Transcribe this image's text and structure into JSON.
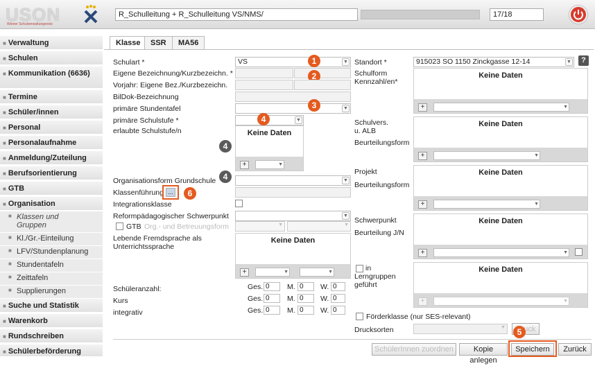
{
  "topbar": {
    "logo_text": "USON",
    "logo_sub": "Wiener Schulverwaltungsnetz",
    "title_field": "R_Schulleitung + R_Schulleitung VS/NMS/",
    "year_field": "17/18"
  },
  "sidebar": {
    "items": [
      "Verwaltung",
      "Schulen",
      "Kommunikation (6636)",
      "Termine",
      "Schüler/innen",
      "Personal",
      "Personalaufnahme",
      "Anmeldung/Zuteilung",
      "Berufsorientierung",
      "GTB",
      "Organisation",
      "Suche und Statistik",
      "Warenkorb",
      "Rundschreiben",
      "Schülerbeförderung"
    ],
    "sub": [
      "Klassen und Gruppen",
      "Kl./Gr.-Einteilung",
      "LFV/Stundenplanung",
      "Stundentafeln",
      "Zeittafeln",
      "Supplierungen"
    ]
  },
  "tabs": [
    "Klasse",
    "SSR",
    "MA56"
  ],
  "form": {
    "schulart_label": "Schulart *",
    "schulart_value": "VS",
    "eig_bez_label": "Eigene Bezeichnung/Kurzbezeichn. *",
    "vorjahr_label": "Vorjahr: Eigene Bez./Kurzbezeichn.",
    "bildok_label": "BilDok-Bezeichnung",
    "prim_stundentafel_label": "primäre Stundentafel",
    "prim_schulstufe_label": "primäre Schulstufe *",
    "erlaubte_label": "erlaubte Schulstufe/n",
    "keine_daten": "Keine Daten",
    "orgform_label": "Organisationsform Grundschule",
    "klassenfuehrung_label": "Klassenführung",
    "klassenfuehrung_btn": "...",
    "integration_label": "Integrationsklasse",
    "reform_label": "Reformpädagogischer Schwerpunkt",
    "gtb_label": "GTB",
    "gtb_form_label": "Org.- und Betreuungsform",
    "fremdsprache_label": "Lebende Fremdsprache als Unterrichtssprache",
    "schueleranzahl_label": "Schüleranzahl:",
    "kurs_label": "Kurs",
    "integrativ_label": "integrativ",
    "ges": "Ges.",
    "m": "M.",
    "w": "W.",
    "zero": "0",
    "standort_label": "Standort *",
    "standort_value": "915023 SO 1150 Zinckgasse 12-14",
    "schulform_label": "Schulform Kennzahl/en*",
    "schulvers_label": "Schulvers. u. ALB",
    "beurteilungsform_label": "Beurteilungsform",
    "projekt_label": "Projekt",
    "schwerpunkt_label": "Schwerpunkt",
    "beurteilung_jn_label": "Beurteilung J/N",
    "lerngruppen_label": "in Lerngruppen geführt",
    "foerder_label": "Förderklasse (nur SES-relevant)",
    "drucksorten_label": "Drucksorten",
    "druck_btn": "Druck",
    "help": "?"
  },
  "buttons": {
    "zuordnen": "SchülerInnen zuordnen",
    "kopie": "Kopie anlegen",
    "speichern": "Speichern",
    "zurueck": "Zurück"
  },
  "badges": [
    "1",
    "2",
    "3",
    "4",
    "4",
    "4",
    "5",
    "6"
  ],
  "colors": {
    "accent_orange": "#e55a1f",
    "badge_gray": "#5a5a5a",
    "power_red": "#d63b2e"
  }
}
